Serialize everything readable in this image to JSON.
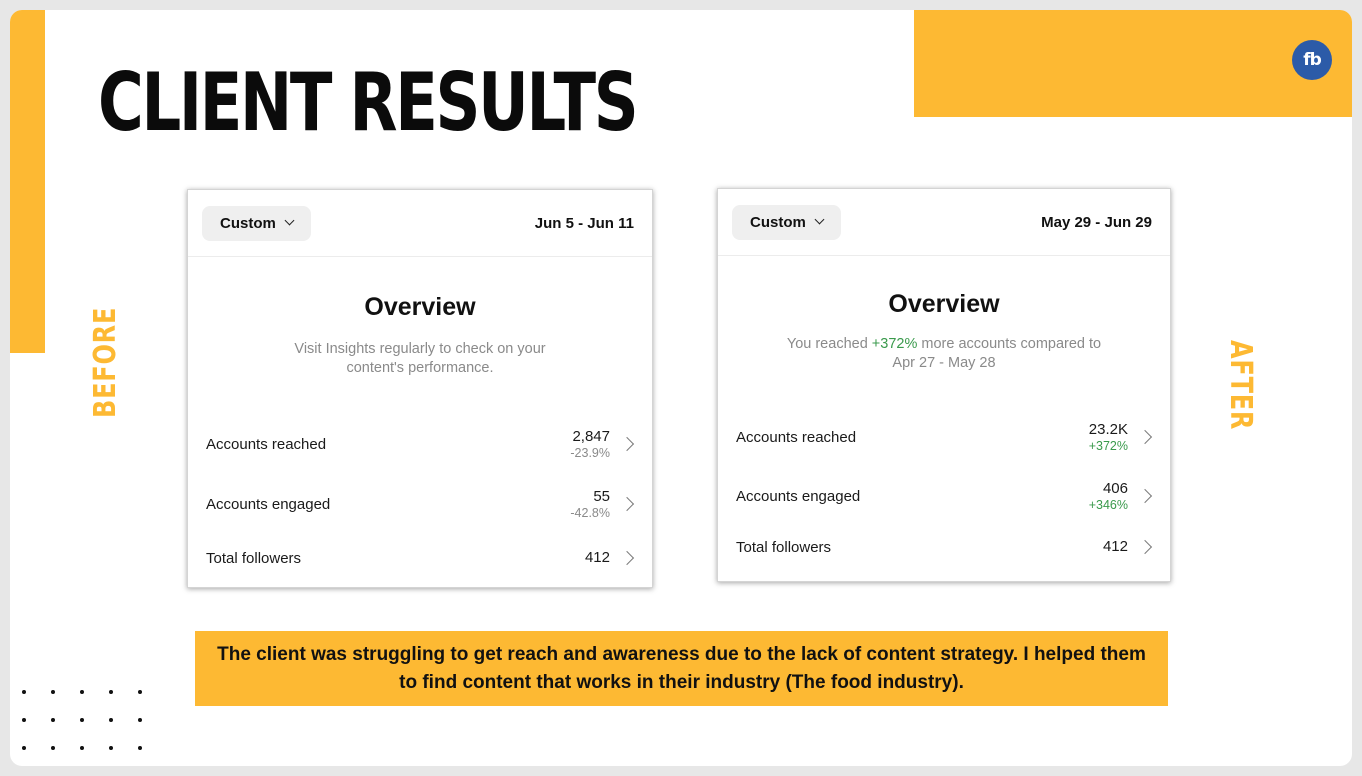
{
  "title": "CLIENT RESULTS",
  "logo_text": "fb",
  "labels": {
    "before": "BEFORE",
    "after": "AFTER"
  },
  "colors": {
    "accent": "#fdb933",
    "logo_bg": "#2c5ba8",
    "positive": "#3a9a4c",
    "muted": "#8a8a8a"
  },
  "before": {
    "range_chip": "Custom",
    "date_range": "Jun 5 - Jun 11",
    "overview_title": "Overview",
    "subtitle_line1": "Visit Insights regularly to check on your",
    "subtitle_line2": "content's performance.",
    "metrics": [
      {
        "label": "Accounts reached",
        "value": "2,847",
        "delta": "-23.9%"
      },
      {
        "label": "Accounts engaged",
        "value": "55",
        "delta": "-42.8%"
      },
      {
        "label": "Total followers",
        "value": "412"
      }
    ]
  },
  "after": {
    "range_chip": "Custom",
    "date_range": "May 29 - Jun 29",
    "overview_title": "Overview",
    "subtitle_prefix": "You reached ",
    "subtitle_highlight": "+372%",
    "subtitle_suffix": " more accounts compared to",
    "subtitle_line2": "Apr 27 - May 28",
    "metrics": [
      {
        "label": "Accounts reached",
        "value": "23.2K",
        "delta": "+372%"
      },
      {
        "label": "Accounts engaged",
        "value": "406",
        "delta": "+346%"
      },
      {
        "label": "Total followers",
        "value": "412"
      }
    ]
  },
  "caption": "The client was struggling to get reach and awareness due to the lack of content strategy. I helped them to find content that works in their industry (The food industry)."
}
